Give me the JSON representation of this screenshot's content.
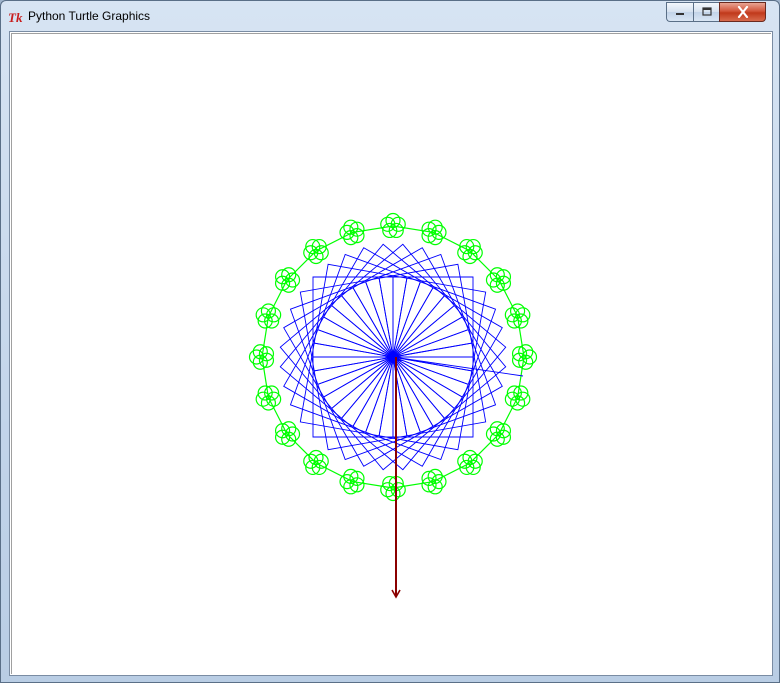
{
  "window": {
    "title": "Python Turtle Graphics",
    "icon": "tk-feather-icon",
    "controls": {
      "minimize": "minimize-icon",
      "maximize": "maximize-icon",
      "close": "close-icon"
    }
  },
  "canvas": {
    "background": "#ffffff",
    "colors": {
      "squares": "#0000ff",
      "rosettes": "#00ff00",
      "arrow": "#8b0000"
    },
    "squares_count": 36,
    "rosettes_count": 20
  }
}
